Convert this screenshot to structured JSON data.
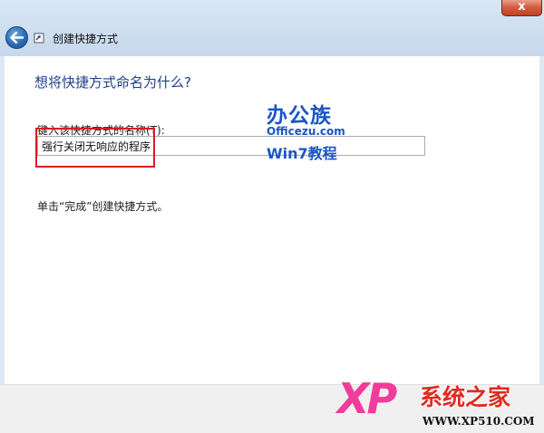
{
  "window": {
    "close_label": "x"
  },
  "header": {
    "title": "创建快捷方式"
  },
  "main": {
    "heading": "想将快捷方式命名为什么?",
    "name_field_label": "键入该快捷方式的名称(T):",
    "name_field_value": "强行关闭无响应的程序",
    "finish_hint": "单击“完成”创建快捷方式。"
  },
  "watermarks": {
    "officezu_title": "办公族",
    "officezu_site": "Officezu.com",
    "officezu_tag": "Win7教程",
    "xp_logo": "XP",
    "xp_name": "系统之家",
    "xp_url": "WWW.XP510.COM"
  },
  "colors": {
    "heading": "#1f3f8a",
    "highlight": "#d81e1e",
    "watermark_blue": "#1a55c4"
  },
  "icons": {
    "back": "back-arrow-icon",
    "wizard": "shortcut-wizard-icon",
    "close": "close-icon"
  }
}
